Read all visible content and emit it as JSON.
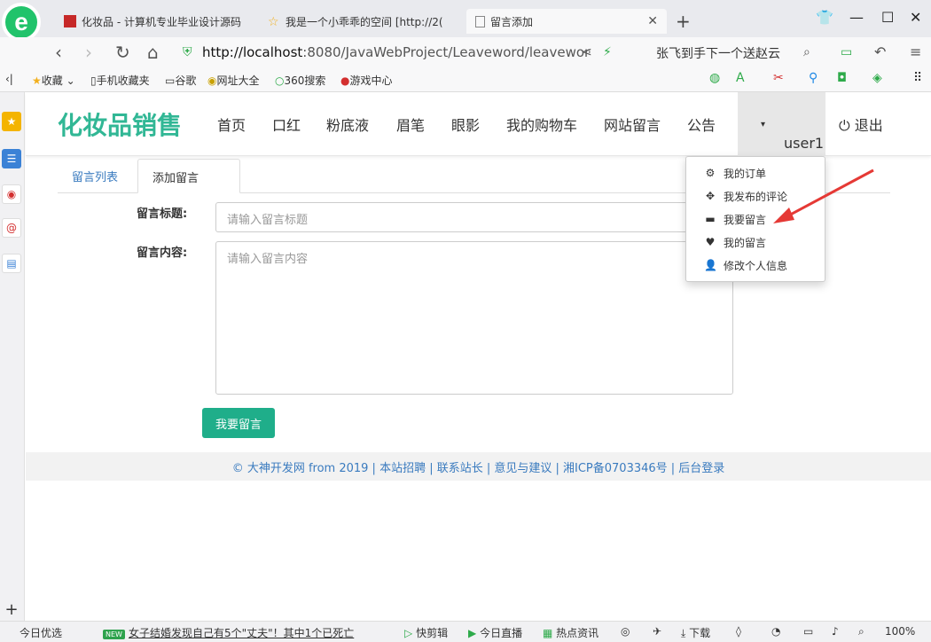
{
  "browser": {
    "tabs": [
      {
        "title": "化妆品 - 计算机专业毕业设计源码"
      },
      {
        "title": "我是一个小乖乖的空间 [http://2("
      },
      {
        "title": "留言添加"
      }
    ],
    "url_host": "http://localhost",
    "url_path": ":8080/JavaWebProject/Leaveword/leavewor",
    "search_text": "张飞到手下一个送赵云",
    "bookmarks": [
      "收藏",
      "手机收藏夹",
      "谷歌",
      "网址大全",
      "360搜索",
      "游戏中心"
    ]
  },
  "site": {
    "brand": "化妆品销售",
    "nav": [
      "首页",
      "口红",
      "粉底液",
      "眉笔",
      "眼影",
      "我的购物车",
      "网站留言",
      "公告"
    ],
    "user": "user1",
    "logout": "退出"
  },
  "tabs": {
    "list": "留言列表",
    "add": "添加留言"
  },
  "form": {
    "title_label": "留言标题:",
    "title_placeholder": "请输入留言标题",
    "content_label": "留言内容:",
    "content_placeholder": "请输入留言内容",
    "submit": "我要留言"
  },
  "dropdown": [
    {
      "icon": "gear-icon",
      "label": "我的订单"
    },
    {
      "icon": "move-icon",
      "label": "我发布的评论"
    },
    {
      "icon": "card-icon",
      "label": "我要留言"
    },
    {
      "icon": "heart-icon",
      "label": "我的留言"
    },
    {
      "icon": "user-icon",
      "label": "修改个人信息"
    }
  ],
  "footer": "© 大神开发网 from 2019 | 本站招聘 | 联系站长 | 意见与建议 | 湘ICP备0703346号 | 后台登录",
  "statusbar": {
    "left": "今日优选",
    "news": "女子结婚发现自己有5个\"丈夫\"！其中1个已死亡",
    "items": [
      "快剪辑",
      "今日直播",
      "热点资讯",
      "下载"
    ],
    "zoom": "100%"
  },
  "colors": {
    "brand": "#31b795",
    "submit": "#1fae8a",
    "link": "#3a7bbf",
    "arrow": "#e53935"
  }
}
